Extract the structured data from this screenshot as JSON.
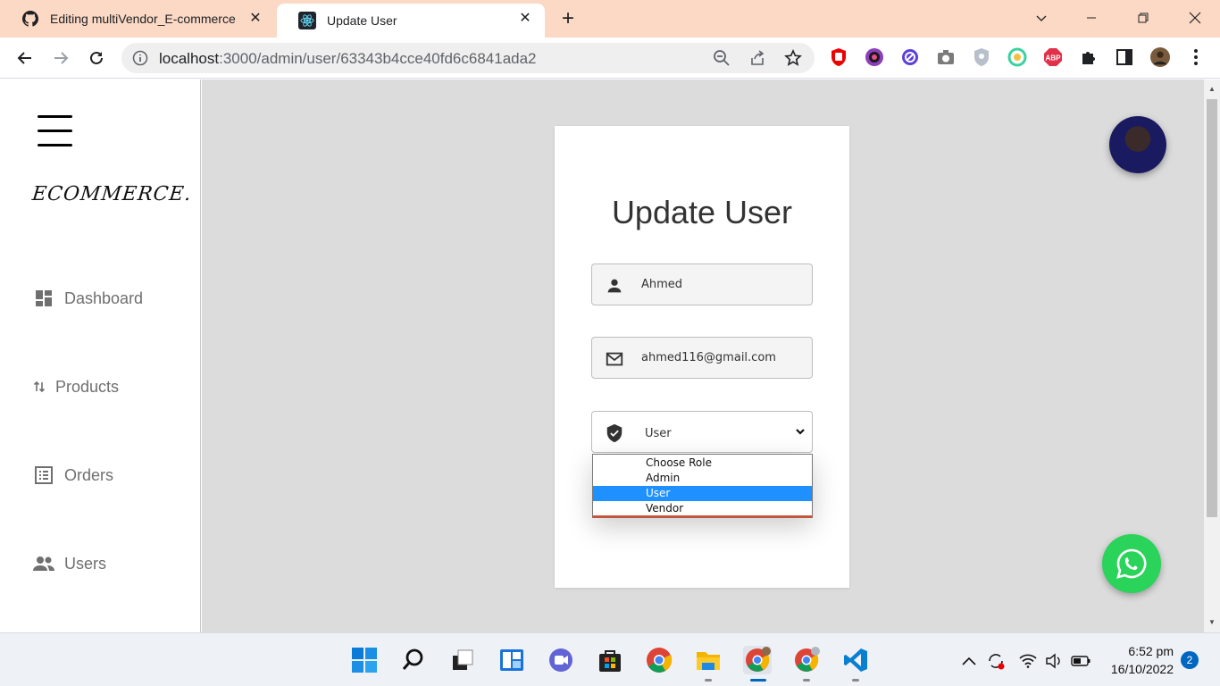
{
  "browser": {
    "tabs": [
      {
        "title": "Editing multiVendor_E-commerce",
        "icon": "github-icon",
        "active": false
      },
      {
        "title": "Update User",
        "icon": "react-icon",
        "active": true
      }
    ],
    "url_host": "localhost",
    "url_path": ":3000/admin/user/63343b4cce40fd6c6841ada2"
  },
  "sidebar": {
    "logo": "ECOMMERCE.",
    "items": [
      {
        "label": "Dashboard",
        "icon": "dashboard-icon"
      },
      {
        "label": "Products",
        "icon": "sort-arrows-icon"
      },
      {
        "label": "Orders",
        "icon": "list-icon"
      },
      {
        "label": "Users",
        "icon": "people-icon"
      }
    ]
  },
  "form": {
    "title": "Update User",
    "name_value": "Ahmed",
    "email_value": "ahmed116@gmail.com",
    "role_value": "User",
    "role_options": [
      "Choose Role",
      "Admin",
      "User",
      "Vendor"
    ],
    "role_selected_index": 2
  },
  "taskbar": {
    "time": "6:52 pm",
    "date": "16/10/2022",
    "notifications": "2"
  },
  "colors": {
    "tabstrip": "#fbd9c4",
    "main_bg": "#dcdcdc",
    "option_highlight": "#1e90ff",
    "whatsapp": "#2ad35a"
  }
}
